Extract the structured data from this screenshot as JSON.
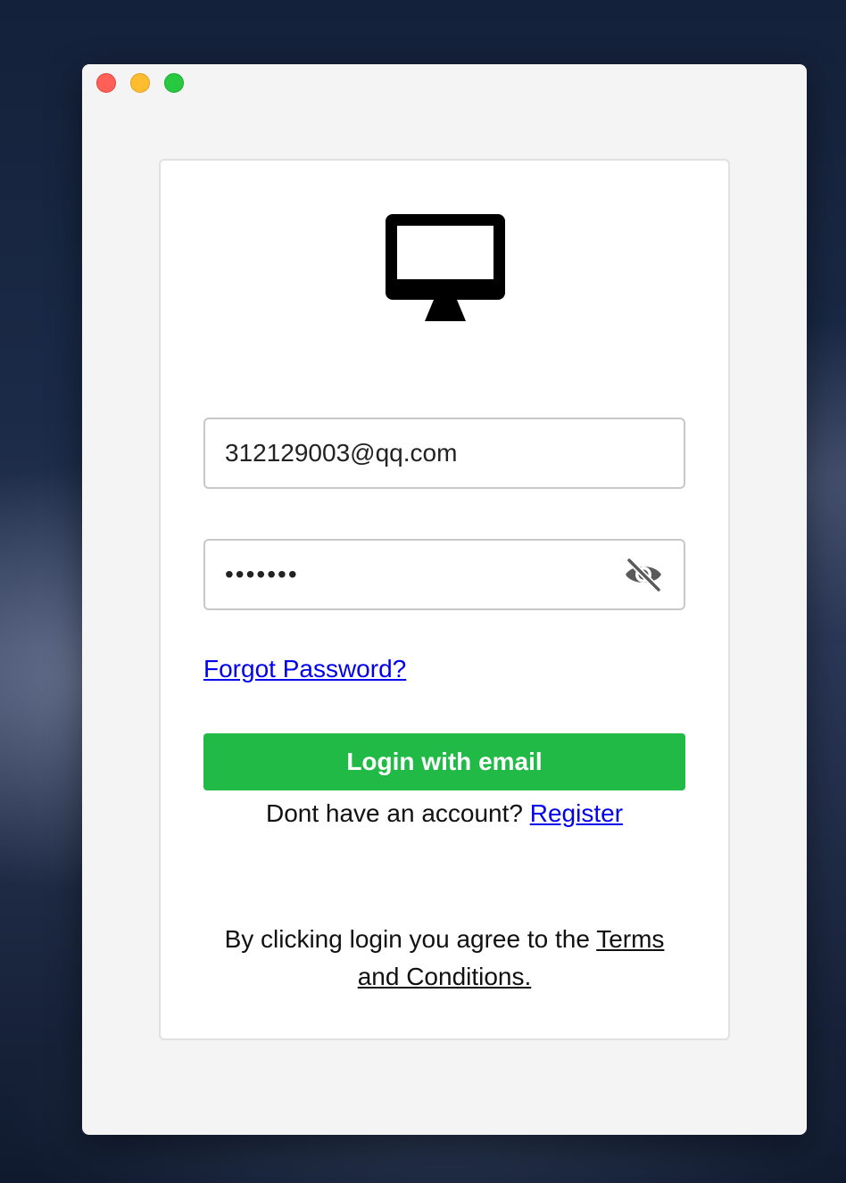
{
  "window": {
    "controls": [
      "close",
      "minimize",
      "maximize"
    ]
  },
  "logo": {
    "icon": "desktop-monitor-icon"
  },
  "email": {
    "value": "312129003@qq.com"
  },
  "password": {
    "value": "1234567",
    "visibility_icon": "eye-slash-icon"
  },
  "links": {
    "forgot_password": "Forgot Password?"
  },
  "login_button": {
    "label": "Login with email",
    "color": "#22ba47"
  },
  "register": {
    "prompt": "Dont have an account? ",
    "link": "Register"
  },
  "terms": {
    "prefix": "By clicking login you agree to the ",
    "link": "Terms and Conditions."
  }
}
